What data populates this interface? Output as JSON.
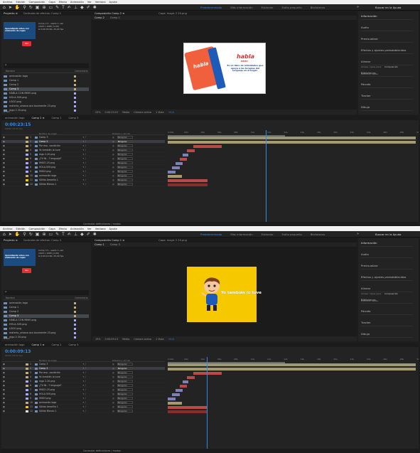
{
  "menu": [
    "Archivo",
    "Edición",
    "Composición",
    "Capa",
    "Efecto",
    "Animación",
    "Ver",
    "Ventana",
    "Ayuda"
  ],
  "workspace": {
    "items": [
      "Predeterminado",
      "Más información",
      "Estándar",
      "Estilo pequeño",
      "Bibliotecas"
    ],
    "more": "»",
    "search": "Buscar en la Ayuda"
  },
  "colors": {
    "accent": "#2d8ceb",
    "panel": "#232323",
    "yellow": "#f5c800",
    "red": "#e62f35"
  },
  "shots": [
    {
      "tabs": {
        "project": "Proyecto ≡",
        "effects": "Controles de efectos: Comp 1",
        "comp": "Composición Comp 2 ≡",
        "footage": "Capa: magic 2 20.png"
      },
      "viewer_tabs": [
        "Comp 2",
        "Comp 1"
      ],
      "project": {
        "thumb_title": "Aprendiendo video con animación de capas",
        "thumb_badge": "Ver",
        "meta": [
          "Comp 2 ▾ , usado 1 vez",
          "1920 x 1080 (1,00)",
          "Δ 0:00:30:00, 25,00 fps"
        ],
        "search": "ρ.",
        "col_name": "Nombre",
        "col_comment": "Comentario",
        "items": [
          {
            "name": "animación logo",
            "color": "#c3ae79"
          },
          {
            "name": "Comp 1",
            "color": "#c3ae79"
          },
          {
            "name": "Comp 2",
            "color": "#c3ae79"
          },
          {
            "name": "Comp 3",
            "color": "#c3ae79"
          },
          {
            "name": "HABLA CON MIMO.png",
            "color": "#a8a8ff"
          },
          {
            "name": "HOLA-509.png",
            "color": "#a8a8ff"
          },
          {
            "name": "LOGO.png",
            "color": "#a8a8ff"
          },
          {
            "name": "materia_urbana ara locamente 23.png",
            "color": "#a8a8ff"
          },
          {
            "name": "mgo 2 20.png",
            "color": "#a8a8ff"
          }
        ],
        "selected": 3,
        "foot": "8 bpc"
      },
      "viewer": {
        "kind": "book",
        "logo": "habla",
        "logo2": "IMMO",
        "text": "Es un libro de actividades que apoya a las terapias del lenguaje en el hogar.",
        "cover": "habla"
      },
      "viewer_foot": {
        "zoom": "23%",
        "time": "0:00:23:15",
        "quality": "Media",
        "view": "Cámara activa",
        "views": "1 Vista",
        "exposure": "+0,0"
      },
      "right": [
        "Información",
        "Audio",
        "Previsualizar",
        "Efectos y ajustes preestablecidos",
        "Alinear",
        "Bibliotecas",
        "Párrafo",
        "Tracker",
        "Dibujo"
      ],
      "align": {
        "to": "Alinear capas para:",
        "option": "Composición",
        "distribute": "Distribuir capas:"
      },
      "timeline": {
        "tabs": [
          "animación logo",
          "Comp 2 ≡",
          "Comp 1",
          "Comp 3"
        ],
        "timecode": "0:00:23:15",
        "timecode_sub": "00590 (25.00 fps)",
        "cols": {
          "name": "Nombre de origen",
          "parent": "Primario y vínculo"
        },
        "ruler": [
          "0:00s",
          "02s",
          "04s",
          "06s",
          "08s",
          "10s",
          "12s",
          "14s",
          "16s",
          "18s",
          "20s",
          "22s",
          "24s",
          "26s",
          "28s",
          "30s"
        ],
        "layers": [
          {
            "n": "1",
            "name": "Comp 3",
            "sw": "#c3ae79",
            "par": "Ninguno"
          },
          {
            "n": "2",
            "name": "Comp 2",
            "sw": "#c3ae79",
            "par": "Ninguno"
          },
          {
            "n": "3",
            "name": "Por eso...condición",
            "sw": "#c3ae79",
            "par": "Ninguno"
          },
          {
            "n": "4",
            "name": "Yo también lo tuve",
            "sw": "#c3ae79",
            "par": "Ninguno"
          },
          {
            "n": "5",
            "name": "mgo 2-20.png",
            "sw": "#a8a8ff",
            "par": "Ninguno"
          },
          {
            "n": "6",
            "name": "¿TU NI...? lenguaje?",
            "sw": "#c3ae79",
            "par": "Ninguno"
          },
          {
            "n": "7",
            "name": "IMIGO-20.png",
            "sw": "#a8a8ff",
            "par": "Ninguno"
          },
          {
            "n": "8",
            "name": "HOLA-509.png",
            "sw": "#a8a8ff",
            "par": "Ninguno"
          },
          {
            "n": "9",
            "name": "IMIGO.png",
            "sw": "#a8a8ff",
            "par": "Ninguno"
          },
          {
            "n": "10",
            "name": "animación logo",
            "sw": "#c3ae79",
            "par": "Ninguno"
          },
          {
            "n": "11",
            "name": "Sólido Amarillo 1",
            "sw": "#f5c800",
            "par": "Ninguno"
          },
          {
            "n": "12",
            "name": "Sólido Blanco 1",
            "sw": "#e0e0e0",
            "par": "Ninguno"
          }
        ],
        "selected": 1,
        "foot": "Conmutar definiciones / modos"
      }
    },
    {
      "tabs": {
        "project": "Proyecto ≡",
        "effects": "Controles de efectos: Comp 3",
        "comp": "Composición Comp 1 ≡",
        "footage": "Capa: magic 2 20.png"
      },
      "viewer_tabs": [
        "Comp 1",
        "Comp 3"
      ],
      "project": {
        "thumb_title": "Aprendiendo video con animación de capas",
        "thumb_badge": "Ver",
        "meta": [
          "Comp 3 ▾ , usado 1 vez",
          "1920 x 1080 (1,00)",
          "Δ 0:00:10:00, 25,00 fps"
        ],
        "search": "ρ.",
        "col_name": "Nombre",
        "col_comment": "Comentario",
        "items": [
          {
            "name": "animación logo",
            "color": "#c3ae79"
          },
          {
            "name": "Comp 1",
            "color": "#c3ae79"
          },
          {
            "name": "Comp 2",
            "color": "#c3ae79"
          },
          {
            "name": "Comp 3",
            "color": "#c3ae79"
          },
          {
            "name": "HABLA CON MIMO.png",
            "color": "#a8a8ff"
          },
          {
            "name": "HOLA-509.png",
            "color": "#a8a8ff"
          },
          {
            "name": "LOGO.png",
            "color": "#a8a8ff"
          },
          {
            "name": "materia_urbana ara locamente 23.png",
            "color": "#a8a8ff"
          },
          {
            "name": "mgo 2 20.png",
            "color": "#a8a8ff"
          }
        ],
        "selected": 3,
        "foot": "8 bpc"
      },
      "viewer": {
        "kind": "boy",
        "text": "Yo también lo tuve"
      },
      "viewer_foot": {
        "zoom": "19%",
        "time": "0:00:09:13",
        "quality": "Media",
        "view": "Cámara activa",
        "views": "1 Vista",
        "exposure": "+0,0"
      },
      "right": [
        "Información",
        "Audio",
        "Previsualizar",
        "Efectos y ajustes preestablecidos",
        "Alinear",
        "Bibliotecas",
        "Párrafo",
        "Tracker",
        "Dibujo"
      ],
      "align": {
        "to": "Alinear capas para:",
        "option": "Composición",
        "distribute": "Distribuir capas:"
      },
      "timeline": {
        "tabs": [
          "animación logo",
          "Comp 1 ≡",
          "Comp 2",
          "Comp 3"
        ],
        "timecode": "0:00:09:13",
        "timecode_sub": "00238 (25.00 fps)",
        "cols": {
          "name": "Nombre de origen",
          "parent": "Primario y vínculo"
        },
        "ruler": [
          "0:00s",
          "02s",
          "04s",
          "06s",
          "08s",
          "10s",
          "12s",
          "14s",
          "16s",
          "18s",
          "20s",
          "22s",
          "24s",
          "26s",
          "28s",
          "30s"
        ],
        "layers": [
          {
            "n": "1",
            "name": "Comp 3",
            "sw": "#c3ae79",
            "par": "Ninguno"
          },
          {
            "n": "2",
            "name": "Comp 2",
            "sw": "#c3ae79",
            "par": "Ninguno"
          },
          {
            "n": "3",
            "name": "Por eso...condición",
            "sw": "#c3ae79",
            "par": "Ninguno"
          },
          {
            "n": "4",
            "name": "Yo también lo tuve",
            "sw": "#c3ae79",
            "par": "Ninguno"
          },
          {
            "n": "5",
            "name": "mgo 2-20.png",
            "sw": "#a8a8ff",
            "par": "Ninguno"
          },
          {
            "n": "6",
            "name": "¿TU NI...? lenguaje?",
            "sw": "#c3ae79",
            "par": "Ninguno"
          },
          {
            "n": "7",
            "name": "IMIGO-20.png",
            "sw": "#a8a8ff",
            "par": "Ninguno"
          },
          {
            "n": "8",
            "name": "HOLA-509.png",
            "sw": "#a8a8ff",
            "par": "Ninguno"
          },
          {
            "n": "9",
            "name": "IMIGO.png",
            "sw": "#a8a8ff",
            "par": "Ninguno"
          },
          {
            "n": "10",
            "name": "animación logo",
            "sw": "#c3ae79",
            "par": "Ninguno"
          },
          {
            "n": "11",
            "name": "Sólido Amarillo 1",
            "sw": "#f5c800",
            "par": "Ninguno"
          },
          {
            "n": "12",
            "name": "Sólido Blanco 1",
            "sw": "#e0e0e0",
            "par": "Ninguno"
          }
        ],
        "selected": 1,
        "foot": "Conmutar definiciones / modos"
      }
    }
  ]
}
